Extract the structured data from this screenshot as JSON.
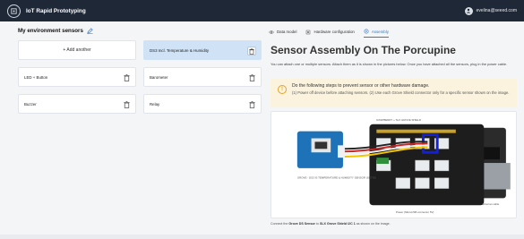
{
  "app": {
    "title": "IoT Rapid Prototyping",
    "user_email": "evelina@seeed.com"
  },
  "sensors": {
    "title": "My environment sensors",
    "add_label": "+ Add another",
    "items": [
      {
        "label": "DS3 Incl. Temperature & Humidity"
      },
      {
        "label": "LED + Button"
      },
      {
        "label": "Barometer"
      },
      {
        "label": "Buzzer"
      },
      {
        "label": "Relay"
      }
    ]
  },
  "tabs": [
    {
      "label": "Data model",
      "icon": "eye-icon"
    },
    {
      "label": "Hardware configuration",
      "icon": "chip-icon"
    },
    {
      "label": "Assembly",
      "icon": "gear-icon"
    }
  ],
  "assembly": {
    "heading": "Sensor Assembly On The Porcupine",
    "description": "You can attach one or multiple sensors. Attach them as it is shown in the pictures below. Once you have attached all the sensors, plug in the power cable.",
    "alert_title": "Do the following steps to prevent sensor or other hardware damage.",
    "alert_body": "(1) Power off device before attaching sensors. (2) Use each Grove Shield connector only for a specific sensor shown on the image.",
    "diagram_labels": {
      "shield": "RASPBERRY + SLX GROVE SHIELD",
      "sensor": "GROVE - DS3 IS TEMPERATURE & HUMIDITY SENSOR (SHT35)",
      "power": "Power (MicroUSB connector 5V)",
      "ethernet": "Ethernet cable"
    },
    "caption_prefix": "Connect the ",
    "caption_sensor": "Grove DS Sensor",
    "caption_mid": " to ",
    "caption_port": "SLX Grove Shield I2C 1",
    "caption_suffix": " as shown on the image."
  }
}
